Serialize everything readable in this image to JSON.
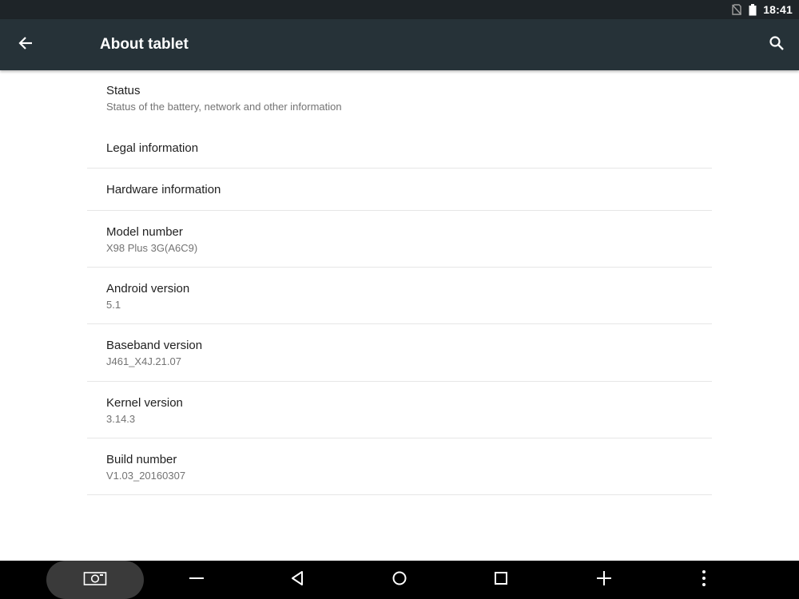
{
  "status_bar": {
    "time": "18:41",
    "icons": [
      "no-sim-icon",
      "battery-icon"
    ]
  },
  "app_bar": {
    "title": "About tablet",
    "back_icon": "arrow-back-icon",
    "search_icon": "search-icon",
    "background": "#263238"
  },
  "items": [
    {
      "title": "Status",
      "summary": "Status of the battery, network and other information"
    },
    {
      "title": "Legal information",
      "summary": ""
    },
    {
      "title": "Hardware information",
      "summary": ""
    },
    {
      "title": "Model number",
      "summary": "X98 Plus 3G(A6C9)"
    },
    {
      "title": "Android version",
      "summary": "5.1"
    },
    {
      "title": "Baseband version",
      "summary": "J461_X4J.21.07"
    },
    {
      "title": "Kernel version",
      "summary": "3.14.3"
    },
    {
      "title": "Build number",
      "summary": "V1.03_20160307"
    }
  ],
  "nav_bar": {
    "buttons": [
      "screenshot-icon",
      "volume-down-icon",
      "back-triangle-icon",
      "home-circle-icon",
      "recents-square-icon",
      "volume-up-icon",
      "more-vert-icon"
    ]
  }
}
